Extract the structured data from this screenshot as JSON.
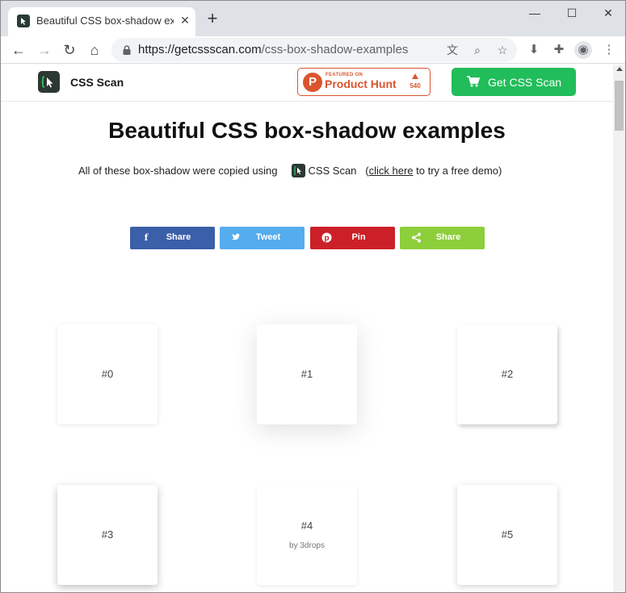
{
  "browser": {
    "tab_title": "Beautiful CSS box-shadow exam",
    "url_host": "https://getcssscan.com",
    "url_path": "/css-box-shadow-examples"
  },
  "header": {
    "brand": "CSS Scan",
    "producthunt": {
      "featured": "FEATURED ON",
      "name": "Product Hunt",
      "count": "540"
    },
    "cta_label": "Get CSS Scan"
  },
  "hero": {
    "title": "Beautiful CSS box-shadow examples",
    "sub_before": "All of these box-shadow were copied using",
    "sub_brand": "CSS Scan",
    "sub_open": "(",
    "sub_link": "click here",
    "sub_after": " to try a free demo)"
  },
  "share": [
    {
      "label": "Share",
      "icon": "facebook-icon",
      "color": "#3b5fa8"
    },
    {
      "label": "Tweet",
      "icon": "twitter-icon",
      "color": "#55acee"
    },
    {
      "label": "Pin",
      "icon": "pinterest-icon",
      "color": "#cb2027"
    },
    {
      "label": "Share",
      "icon": "share-icon",
      "color": "#8dce3b"
    }
  ],
  "cards": [
    {
      "label": "#0",
      "sub": ""
    },
    {
      "label": "#1",
      "sub": ""
    },
    {
      "label": "#2",
      "sub": ""
    },
    {
      "label": "#3",
      "sub": ""
    },
    {
      "label": "#4",
      "sub": "by 3drops"
    },
    {
      "label": "#5",
      "sub": ""
    }
  ]
}
